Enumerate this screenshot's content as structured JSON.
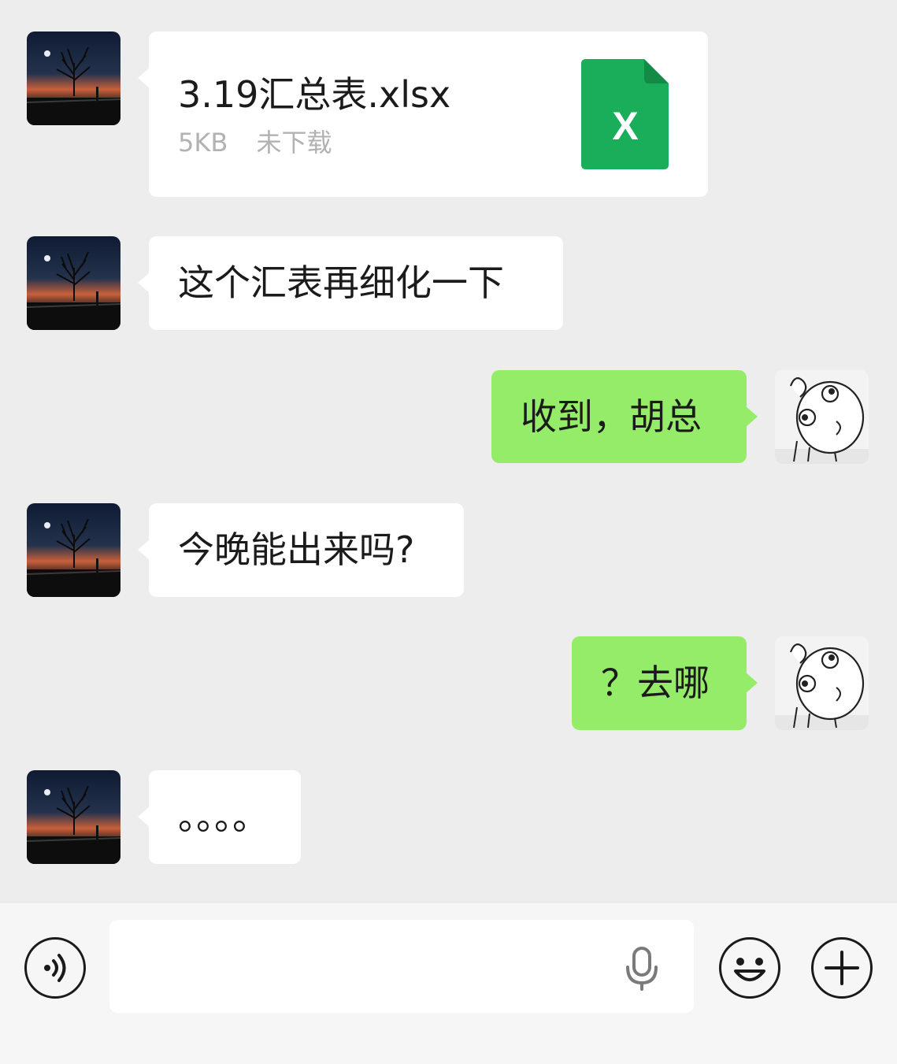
{
  "messages": [
    {
      "side": "left",
      "kind": "file",
      "file_name": "3.19汇总表.xlsx",
      "file_size": "5KB",
      "file_status": "未下载",
      "file_icon": "excel-file-icon",
      "file_icon_letter": "X",
      "file_icon_color": "#1aad5a"
    },
    {
      "side": "left",
      "kind": "text",
      "text": "这个汇表再细化一下"
    },
    {
      "side": "right",
      "kind": "text",
      "text": "收到，胡总"
    },
    {
      "side": "left",
      "kind": "text",
      "text": "今晚能出来吗?"
    },
    {
      "side": "right",
      "kind": "text",
      "text": "？去哪"
    },
    {
      "side": "left",
      "kind": "text",
      "text": "。。。。"
    }
  ],
  "input": {
    "placeholder": "",
    "value": ""
  },
  "icons": {
    "voice": "voice-toggle-icon",
    "mic": "microphone-icon",
    "emoji": "emoji-icon",
    "plus": "plus-icon"
  },
  "colors": {
    "background": "#ededed",
    "incoming_bubble": "#ffffff",
    "outgoing_bubble": "#95ec69",
    "excel_green": "#1aad5a"
  }
}
